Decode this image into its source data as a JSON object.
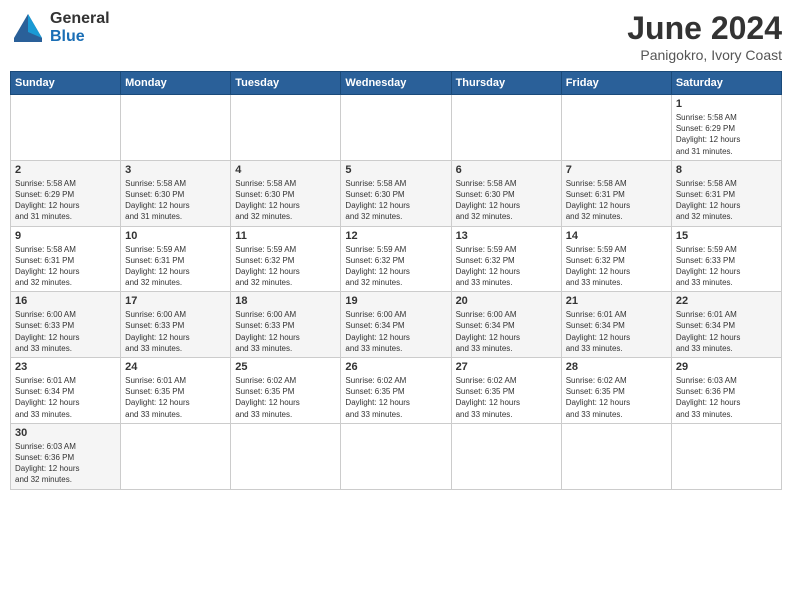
{
  "header": {
    "logo_general": "General",
    "logo_blue": "Blue",
    "title": "June 2024",
    "subtitle": "Panigokro, Ivory Coast"
  },
  "weekdays": [
    "Sunday",
    "Monday",
    "Tuesday",
    "Wednesday",
    "Thursday",
    "Friday",
    "Saturday"
  ],
  "weeks": [
    [
      {
        "day": "",
        "info": ""
      },
      {
        "day": "",
        "info": ""
      },
      {
        "day": "",
        "info": ""
      },
      {
        "day": "",
        "info": ""
      },
      {
        "day": "",
        "info": ""
      },
      {
        "day": "",
        "info": ""
      },
      {
        "day": "1",
        "info": "Sunrise: 5:58 AM\nSunset: 6:29 PM\nDaylight: 12 hours\nand 31 minutes."
      }
    ],
    [
      {
        "day": "2",
        "info": "Sunrise: 5:58 AM\nSunset: 6:29 PM\nDaylight: 12 hours\nand 31 minutes."
      },
      {
        "day": "3",
        "info": "Sunrise: 5:58 AM\nSunset: 6:30 PM\nDaylight: 12 hours\nand 31 minutes."
      },
      {
        "day": "4",
        "info": "Sunrise: 5:58 AM\nSunset: 6:30 PM\nDaylight: 12 hours\nand 32 minutes."
      },
      {
        "day": "5",
        "info": "Sunrise: 5:58 AM\nSunset: 6:30 PM\nDaylight: 12 hours\nand 32 minutes."
      },
      {
        "day": "6",
        "info": "Sunrise: 5:58 AM\nSunset: 6:30 PM\nDaylight: 12 hours\nand 32 minutes."
      },
      {
        "day": "7",
        "info": "Sunrise: 5:58 AM\nSunset: 6:31 PM\nDaylight: 12 hours\nand 32 minutes."
      },
      {
        "day": "8",
        "info": "Sunrise: 5:58 AM\nSunset: 6:31 PM\nDaylight: 12 hours\nand 32 minutes."
      }
    ],
    [
      {
        "day": "9",
        "info": "Sunrise: 5:58 AM\nSunset: 6:31 PM\nDaylight: 12 hours\nand 32 minutes."
      },
      {
        "day": "10",
        "info": "Sunrise: 5:59 AM\nSunset: 6:31 PM\nDaylight: 12 hours\nand 32 minutes."
      },
      {
        "day": "11",
        "info": "Sunrise: 5:59 AM\nSunset: 6:32 PM\nDaylight: 12 hours\nand 32 minutes."
      },
      {
        "day": "12",
        "info": "Sunrise: 5:59 AM\nSunset: 6:32 PM\nDaylight: 12 hours\nand 32 minutes."
      },
      {
        "day": "13",
        "info": "Sunrise: 5:59 AM\nSunset: 6:32 PM\nDaylight: 12 hours\nand 33 minutes."
      },
      {
        "day": "14",
        "info": "Sunrise: 5:59 AM\nSunset: 6:32 PM\nDaylight: 12 hours\nand 33 minutes."
      },
      {
        "day": "15",
        "info": "Sunrise: 5:59 AM\nSunset: 6:33 PM\nDaylight: 12 hours\nand 33 minutes."
      }
    ],
    [
      {
        "day": "16",
        "info": "Sunrise: 6:00 AM\nSunset: 6:33 PM\nDaylight: 12 hours\nand 33 minutes."
      },
      {
        "day": "17",
        "info": "Sunrise: 6:00 AM\nSunset: 6:33 PM\nDaylight: 12 hours\nand 33 minutes."
      },
      {
        "day": "18",
        "info": "Sunrise: 6:00 AM\nSunset: 6:33 PM\nDaylight: 12 hours\nand 33 minutes."
      },
      {
        "day": "19",
        "info": "Sunrise: 6:00 AM\nSunset: 6:34 PM\nDaylight: 12 hours\nand 33 minutes."
      },
      {
        "day": "20",
        "info": "Sunrise: 6:00 AM\nSunset: 6:34 PM\nDaylight: 12 hours\nand 33 minutes."
      },
      {
        "day": "21",
        "info": "Sunrise: 6:01 AM\nSunset: 6:34 PM\nDaylight: 12 hours\nand 33 minutes."
      },
      {
        "day": "22",
        "info": "Sunrise: 6:01 AM\nSunset: 6:34 PM\nDaylight: 12 hours\nand 33 minutes."
      }
    ],
    [
      {
        "day": "23",
        "info": "Sunrise: 6:01 AM\nSunset: 6:34 PM\nDaylight: 12 hours\nand 33 minutes."
      },
      {
        "day": "24",
        "info": "Sunrise: 6:01 AM\nSunset: 6:35 PM\nDaylight: 12 hours\nand 33 minutes."
      },
      {
        "day": "25",
        "info": "Sunrise: 6:02 AM\nSunset: 6:35 PM\nDaylight: 12 hours\nand 33 minutes."
      },
      {
        "day": "26",
        "info": "Sunrise: 6:02 AM\nSunset: 6:35 PM\nDaylight: 12 hours\nand 33 minutes."
      },
      {
        "day": "27",
        "info": "Sunrise: 6:02 AM\nSunset: 6:35 PM\nDaylight: 12 hours\nand 33 minutes."
      },
      {
        "day": "28",
        "info": "Sunrise: 6:02 AM\nSunset: 6:35 PM\nDaylight: 12 hours\nand 33 minutes."
      },
      {
        "day": "29",
        "info": "Sunrise: 6:03 AM\nSunset: 6:36 PM\nDaylight: 12 hours\nand 33 minutes."
      }
    ],
    [
      {
        "day": "30",
        "info": "Sunrise: 6:03 AM\nSunset: 6:36 PM\nDaylight: 12 hours\nand 32 minutes."
      },
      {
        "day": "",
        "info": ""
      },
      {
        "day": "",
        "info": ""
      },
      {
        "day": "",
        "info": ""
      },
      {
        "day": "",
        "info": ""
      },
      {
        "day": "",
        "info": ""
      },
      {
        "day": "",
        "info": ""
      }
    ]
  ]
}
